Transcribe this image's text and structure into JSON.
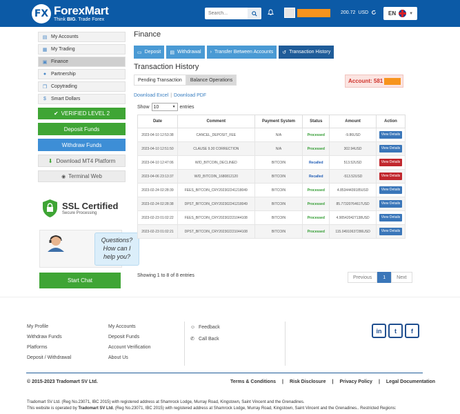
{
  "header": {
    "logo_badge": "FX",
    "logo_name": "ForexMart",
    "logo_tagline_pre": "Think ",
    "logo_tagline_bold": "BIG",
    "logo_tagline_post": ". Trade Forex",
    "search_placeholder": "Search...",
    "balance": "200.72",
    "currency": "USD",
    "language": "EN"
  },
  "sidebar": {
    "items": [
      {
        "label": "My Accounts",
        "icon": "document-icon"
      },
      {
        "label": "My Trading",
        "icon": "chart-icon"
      },
      {
        "label": "Finance",
        "icon": "folder-icon"
      },
      {
        "label": "Partnership",
        "icon": "users-icon"
      },
      {
        "label": "Copytrading",
        "icon": "copy-icon"
      },
      {
        "label": "Smart Dollars",
        "icon": "dollar-icon"
      }
    ],
    "verified": "VERIFIED LEVEL 2",
    "deposit": "Deposit Funds",
    "withdraw": "Withdraw Funds",
    "mt4": "Download MT4 Platform",
    "terminal": "Terminal Web",
    "ssl_title": "SSL Certified",
    "ssl_sub": "Secure Processing",
    "chat_line1": "Questions?",
    "chat_line2": "How can I",
    "chat_line3": "help you?",
    "start_chat": "Start Chat"
  },
  "main": {
    "title": "Finance",
    "tabs": [
      "Deposit",
      "Withdrawal",
      "Transfer Between Accounts",
      "Transaction History"
    ],
    "subtitle": "Transaction History",
    "subtabs": [
      "Pending Transaction",
      "Balance Operations"
    ],
    "account_label": "Account: 581",
    "download_excel": "Download Excel",
    "download_pdf": "Download PDF",
    "show_label": "Show",
    "show_value": "10",
    "entries_label": "entries",
    "columns": [
      "Date",
      "Comment",
      "Payment System",
      "Status",
      "Amount",
      "Action"
    ],
    "rows": [
      {
        "date": "2023-04-10 12:53:38",
        "comment": "CANCEL_DEPOSIT_FEE",
        "system": "N/A",
        "status": "Processed",
        "amount": "-9.86USD",
        "action": "View Details",
        "type": "blue"
      },
      {
        "date": "2023-04-10 12:51:50",
        "comment": "CLAUSE 9.30 CORRECTION",
        "system": "N/A",
        "status": "Processed",
        "amount": "302.94USD",
        "action": "View Details",
        "type": "blue"
      },
      {
        "date": "2023-04-10 12:47:06",
        "comment": "W/D_BITCOIN_DECLINED",
        "system": "BITCOIN",
        "status": "Recalled",
        "amount": "513.52USD",
        "action": "View Details",
        "type": "red"
      },
      {
        "date": "2023-04-06 23:13:37",
        "comment": "W/D_BITCOIN_1680812120",
        "system": "BITCOIN",
        "status": "Recalled",
        "amount": "-513.52USD",
        "action": "View Details",
        "type": "red"
      },
      {
        "date": "2023-02-24 02:28:39",
        "comment": "FEES_BITCOIN_CRY202302241218049",
        "system": "BITCOIN",
        "status": "Processed",
        "amount": "4.85344439185USD",
        "action": "View Details",
        "type": "blue"
      },
      {
        "date": "2023-02-24 02:28:38",
        "comment": "DPST_BITCOIN_CRY202302241218049",
        "system": "BITCOIN",
        "status": "Processed",
        "amount": "85.77320764617USD",
        "action": "View Details",
        "type": "blue"
      },
      {
        "date": "2023-02-23 01:02:22",
        "comment": "FEES_BITCOIN_CRY202302221044108",
        "system": "BITCOIN",
        "status": "Processed",
        "amount": "4.905420427138USD",
        "action": "View Details",
        "type": "blue"
      },
      {
        "date": "2023-02-23 01:02:21",
        "comment": "DPST_BITCOIN_CRY202302221044108",
        "system": "BITCOIN",
        "status": "Processed",
        "amount": "115.04910637286USD",
        "action": "View Details",
        "type": "blue"
      }
    ],
    "showing": "Showing 1 to 8 of 8 entries",
    "pager": [
      "Previous",
      "1",
      "Next"
    ]
  },
  "footer": {
    "col1": [
      "My Profile",
      "Withdraw Funds",
      "Platforms",
      "Deposit / Withdrawal"
    ],
    "col2": [
      "My Accounts",
      "Deposit Funds",
      "Account Verification",
      "About Us"
    ],
    "feedback": "Feedback",
    "callback": "Call Back",
    "social": [
      "in",
      "t",
      "f"
    ],
    "copyright": "© 2015-2023 Tradomart SV Ltd.",
    "legal": [
      "Terms & Conditions",
      "Risk Disclosure",
      "Privacy Policy",
      "Legal Documentation"
    ],
    "reg_line1": "Tradomart SV Ltd. (Reg No.23071, IBC 2015) with registered address at Shamrock Lodge, Murray Road, Kingstown, Saint Vincent and the Grenadines.",
    "reg_line2_pre": "This website is operated by ",
    "reg_line2_bold": "Tradomart SV Ltd.",
    "reg_line2_post": " (Reg No.23071, IBC 2015) with registered address at Shamrock Lodge, Murray Road, Kingstown, Saint Vincent and the Grenadines.. Restricted Regions:"
  },
  "colors": {
    "brand": "#0c5aa6",
    "green": "#3fa535",
    "blue": "#3d8ed6",
    "mask": "#f7941d"
  }
}
